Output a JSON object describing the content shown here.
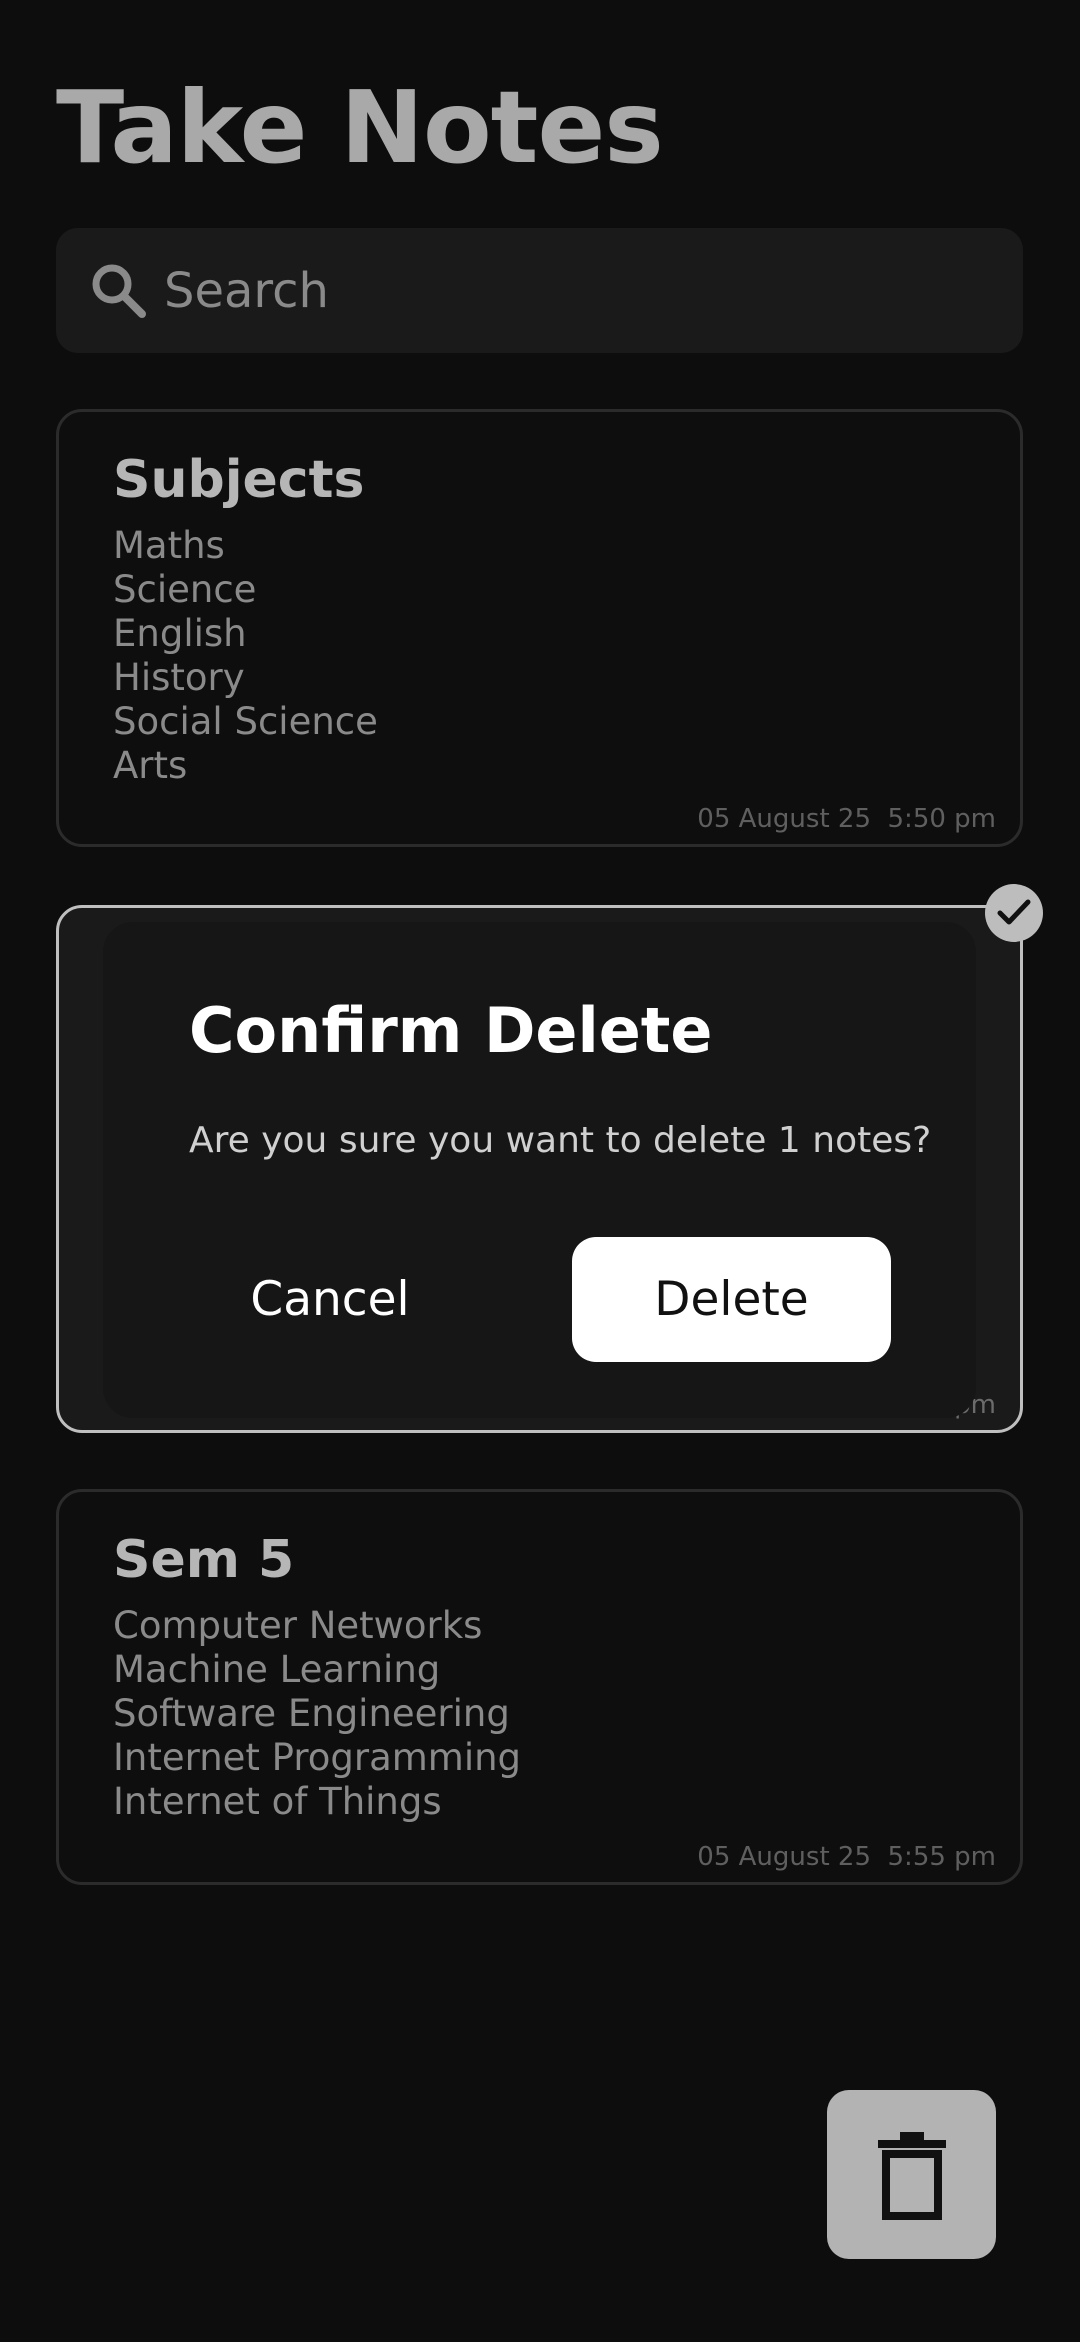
{
  "header": {
    "title": "Take Notes"
  },
  "search": {
    "placeholder": "Search",
    "icon": "search-icon"
  },
  "notes": [
    {
      "title": "Subjects",
      "lines": [
        "Maths",
        "Science",
        "English",
        "History",
        "Social Science",
        "Arts"
      ],
      "date": "05 August 25  5:50 pm",
      "selected": false
    },
    {
      "title": "",
      "lines": [],
      "date": "pm",
      "selected": true
    },
    {
      "title": "Sem 5",
      "lines": [
        "Computer Networks",
        "Machine Learning",
        "Software Engineering",
        "Internet Programming",
        "Internet of Things"
      ],
      "date": "05 August 25  5:55 pm",
      "selected": false
    }
  ],
  "dialog": {
    "title": "Confirm Delete",
    "message": "Are you sure you want to delete 1 notes?",
    "cancel_label": "Cancel",
    "delete_label": "Delete"
  },
  "fab": {
    "icon": "trash-icon"
  },
  "colors": {
    "background": "#0d0d0d",
    "surface": "#1a1a1a",
    "accent": "#ffffff",
    "fab": "#b3b3b3"
  }
}
